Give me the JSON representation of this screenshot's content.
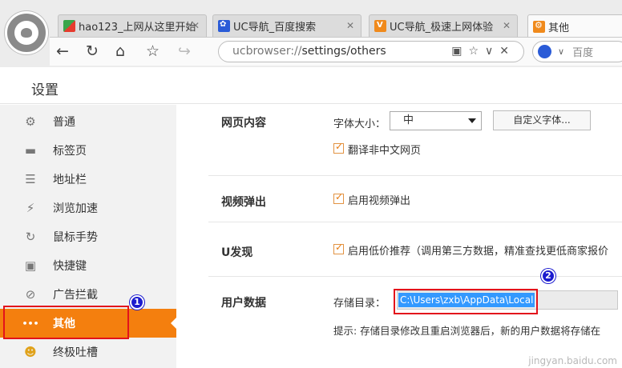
{
  "tabs": [
    {
      "title": "hao123_上网从这里开始",
      "icon": "hao123-icon"
    },
    {
      "title": "UC导航_百度搜索",
      "icon": "baidu-paw-icon"
    },
    {
      "title": "UC导航_极速上网体验",
      "icon": "uc-v-icon"
    },
    {
      "title": "其他",
      "icon": "settings-gear-icon"
    }
  ],
  "tab_close": "✕",
  "url": {
    "scheme": "ucbrowser://",
    "path": "settings/others"
  },
  "search": {
    "engine_label": "百度"
  },
  "page_title": "设置",
  "sidebar": {
    "items": [
      {
        "label": "普通",
        "icon": "⚙"
      },
      {
        "label": "标签页",
        "icon": "▬"
      },
      {
        "label": "地址栏",
        "icon": "☰"
      },
      {
        "label": "浏览加速",
        "icon": "⚡"
      },
      {
        "label": "鼠标手势",
        "icon": "↻"
      },
      {
        "label": "快捷键",
        "icon": "▣"
      },
      {
        "label": "广告拦截",
        "icon": "⊘"
      },
      {
        "label": "其他",
        "icon": "•••",
        "active": true
      },
      {
        "label": "终极吐槽",
        "icon": "☻"
      }
    ]
  },
  "sections": {
    "web_content": {
      "label": "网页内容",
      "font_size_label": "字体大小：",
      "font_size_value": "中",
      "custom_font_button": "自定义字体...",
      "translate_label": "翻译非中文网页"
    },
    "video_popup": {
      "label": "视频弹出",
      "option_label": "启用视频弹出"
    },
    "u_discover": {
      "label": "U发现",
      "option_label": "启用低价推荐（调用第三方数据，精准查找更低商家报价"
    },
    "user_data": {
      "label": "用户数据",
      "storage_label": "存储目录：",
      "storage_path": "C:\\Users\\zxb\\AppData\\Local",
      "hint": "提示: 存储目录修改且重启浏览器后，新的用户数据将存储在"
    }
  },
  "annotations": {
    "badge1": "1",
    "badge2": "2"
  },
  "watermark": "jingyan.baidu.com",
  "colors": {
    "accent": "#f47f0e",
    "annotation_red": "#e3121b",
    "annotation_blue": "#1c1ccf",
    "selection": "#3399ff"
  }
}
